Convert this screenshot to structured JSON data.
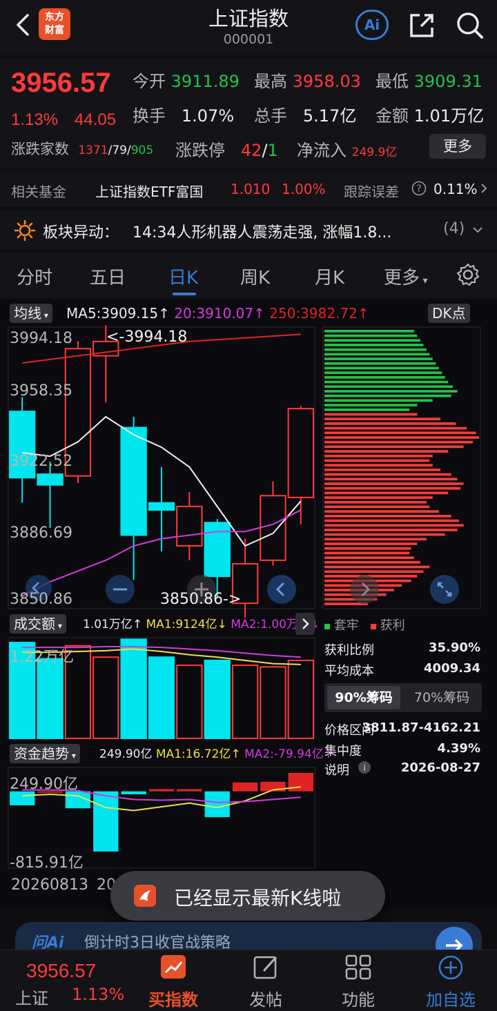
{
  "header": {
    "title": "上证指数",
    "code": "000001",
    "logo_text_1": "东方",
    "logo_text_2": "财富",
    "ai_label": "Ai"
  },
  "quote": {
    "price": "3956.57",
    "change_pct": "1.13%",
    "change_abs": "44.05",
    "open_label": "今开",
    "open": "3911.89",
    "high_label": "最高",
    "high": "3958.03",
    "low_label": "最低",
    "low": "3909.31",
    "turnover_label": "换手",
    "turnover": "1.07%",
    "volume_label": "总手",
    "volume": "5.17亿",
    "amount_label": "金额",
    "amount": "1.01万亿",
    "breadth_label": "涨跌家数",
    "breadth_up": "1371",
    "breadth_flat": "79",
    "breadth_down": "905",
    "slash": "/",
    "limit_label": "涨跌停",
    "limit_up": "42",
    "limit_down": "1",
    "inflow_label": "净流入",
    "inflow": "249.9亿",
    "more_button": "更多"
  },
  "fund": {
    "label": "相关基金",
    "name": "上证指数ETF富国",
    "price": "1.010",
    "pct": "1.00%",
    "error_label": "跟踪误差",
    "error_value": "0.11%"
  },
  "sector": {
    "label": "板块异动：",
    "text": "14:34人形机器人震荡走强, 涨幅1.8...",
    "count": "(4)"
  },
  "tabs": [
    "分时",
    "五日",
    "日K",
    "周K",
    "月K",
    "更多"
  ],
  "active_tab": 2,
  "kline": {
    "ma_selector": "均线",
    "ma5": "MA5:3909.15",
    "ma20": "20:3910.07",
    "ma250": "250:3982.72",
    "up_arrow": "↑",
    "dk_button": "DK点",
    "y_labels": [
      "3994.18",
      "3958.35",
      "3922.52",
      "3886.69",
      "3850.86"
    ],
    "high_marker": "<-3994.18",
    "low_marker": "3850.86->",
    "candles": [
      {
        "o": 3955,
        "c": 3918,
        "h": 3963,
        "l": 3904
      },
      {
        "o": 3920,
        "c": 3914,
        "h": 3927,
        "l": 3890
      },
      {
        "o": 3919,
        "c": 3990,
        "h": 3994.18,
        "l": 3915
      },
      {
        "o": 3986,
        "c": 3994,
        "h": 4003,
        "l": 3960
      },
      {
        "o": 3946,
        "c": 3886,
        "h": 3952,
        "l": 3861
      },
      {
        "o": 3904,
        "c": 3900,
        "h": 3924,
        "l": 3877
      },
      {
        "o": 3880,
        "c": 3902,
        "h": 3910,
        "l": 3872
      },
      {
        "o": 3893,
        "c": 3863,
        "h": 3895,
        "l": 3850.86
      },
      {
        "o": 3848,
        "c": 3870,
        "h": 3884,
        "l": 3840
      },
      {
        "o": 3872,
        "c": 3908,
        "h": 3916,
        "l": 3869
      },
      {
        "o": 3907,
        "c": 3956.57,
        "h": 3958.03,
        "l": 3892
      }
    ],
    "ma5_line": [
      3932,
      3930,
      3938,
      3952,
      3942,
      3935,
      3924,
      3902,
      3880,
      3887,
      3905
    ],
    "ma20_line": [
      3852,
      3860,
      3866,
      3872,
      3880,
      3884,
      3886,
      3888,
      3888,
      3892,
      3900
    ],
    "ma250_line": [
      3982,
      3984,
      3986,
      3988,
      3990,
      3992,
      3994,
      3995,
      3996,
      3997,
      3998
    ],
    "y_range": [
      3845,
      4002
    ]
  },
  "chip": {
    "legend_trapped": "套牢",
    "legend_profit": "获利",
    "profit_ratio_label": "获利比例",
    "profit_ratio": "35.90%",
    "avg_cost_label": "平均成本",
    "avg_cost": "4009.34",
    "tab_90": "90%筹码",
    "tab_70": "70%筹码",
    "range_label": "价格区间",
    "range": "3811.87-4162.21",
    "concentration_label": "集中度",
    "concentration": "4.39%",
    "note_label": "说明",
    "date": "2026-08-27",
    "green_bars": [
      0.58,
      0.6,
      0.62,
      0.64,
      0.66,
      0.68,
      0.7,
      0.72,
      0.74,
      0.76,
      0.78,
      0.8,
      0.83,
      0.86,
      0.82,
      0.7,
      0.6,
      0.55
    ],
    "red_bars": [
      0.6,
      0.75,
      0.85,
      0.92,
      0.98,
      1.0,
      0.96,
      0.9,
      0.8,
      0.7,
      0.68,
      0.7,
      0.75,
      0.82,
      0.86,
      0.9,
      0.88,
      0.8,
      0.7,
      0.66,
      0.68,
      0.74,
      0.82,
      0.87,
      0.9,
      0.86,
      0.78,
      0.66,
      0.6,
      0.56,
      0.55,
      0.58,
      0.62,
      0.68,
      0.64,
      0.6,
      0.56,
      0.5,
      0.45,
      0.4,
      0.34,
      0.28
    ]
  },
  "volume": {
    "selector": "成交额",
    "value": "1.01万亿",
    "ma1": "MA1:9124亿",
    "ma2": "MA2:1.00万亿",
    "up_arrow": "↑",
    "down_arrow": "↓",
    "y_label": "1.22万亿",
    "bars": [
      1.18,
      0.98,
      1.14,
      1.0,
      1.22,
      1.0,
      0.9,
      0.96,
      0.9,
      0.88,
      0.96
    ],
    "ma1_line": [
      1.06,
      1.06,
      1.07,
      1.08,
      1.1,
      1.07,
      1.03,
      1.0,
      0.96,
      0.92,
      0.91
    ],
    "ma2_line": [
      1.12,
      1.12,
      1.12,
      1.13,
      1.13,
      1.12,
      1.1,
      1.08,
      1.05,
      1.02,
      1.0
    ]
  },
  "fund_flow": {
    "selector": "资金趋势",
    "value": "249.90亿",
    "ma1": "MA1:16.72亿",
    "ma2": "MA2:-79.94亿",
    "up_arrow": "↑",
    "y_top": "249.90亿",
    "y_bottom": "-815.91亿",
    "bars": [
      -190,
      0,
      -230,
      -815.91,
      -40,
      30,
      30,
      -350,
      120,
      130,
      249.9
    ],
    "ma1_line": [
      -60,
      -40,
      -60,
      -220,
      -260,
      -210,
      -160,
      -220,
      -130,
      20,
      60
    ],
    "ma2_line": [
      20,
      20,
      10,
      -60,
      -110,
      -120,
      -110,
      -150,
      -140,
      -110,
      -80
    ],
    "date_left": "20260813",
    "date_partial": "20"
  },
  "toast": {
    "text": "已经显示最新K线啦"
  },
  "ai_banner": {
    "logo": "问Ai",
    "text": "倒计时3日收官战策略"
  },
  "bottom_nav": {
    "price": "3956.57",
    "name": "上证",
    "pct": "1.13%",
    "buy": "买指数",
    "post": "发帖",
    "func": "功能",
    "add": "加自选"
  },
  "colors": {
    "up": "#ff3b3b",
    "down": "#24c24a",
    "accent": "#3a7bd5",
    "candle_down": "#00e5ee",
    "ma20": "#d63adf",
    "ma250": "#e02424",
    "ma1_yellow": "#f0e04a"
  }
}
